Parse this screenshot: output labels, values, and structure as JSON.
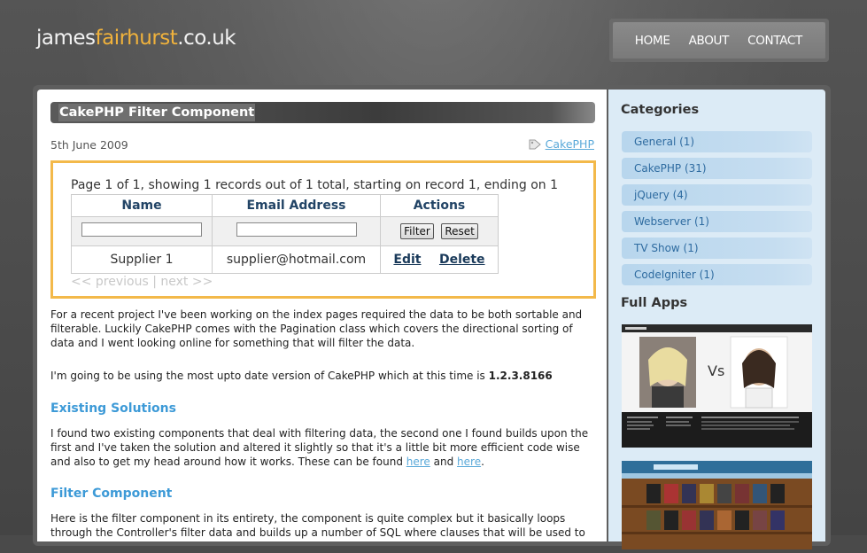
{
  "header": {
    "logo_prefix": "james",
    "logo_accent": "fairhurst",
    "logo_suffix": ".co.uk",
    "nav": [
      "HOME",
      "ABOUT",
      "CONTACT"
    ]
  },
  "post": {
    "title": "CakePHP Filter Component",
    "date": "5th June 2009",
    "tag": "CakePHP"
  },
  "demo": {
    "paging_text": "Page 1 of 1, showing 1 records out of 1 total, starting on record 1, ending on 1",
    "columns": [
      "Name",
      "Email Address",
      "Actions"
    ],
    "filter_button": "Filter",
    "reset_button": "Reset",
    "row": {
      "name": "Supplier 1",
      "email": "supplier@hotmail.com",
      "edit": "Edit",
      "delete": "Delete"
    },
    "previous": "<< previous",
    "separator": "|",
    "next": "next >>"
  },
  "content": {
    "p1": "For a recent project I've been working on the index pages required the data to be both sortable and filterable. Luckily CakePHP comes with the Pagination class which covers the directional sorting of data and I went looking online for something that will filter the data.",
    "p2_text": "I'm going to be using the most upto date version of CakePHP which at this time is ",
    "p2_version": "1.2.3.8166",
    "h1": "Existing Solutions",
    "p3_text": "I found two existing components that deal with filtering data, the second one I found builds upon the first and I've taken the solution and altered it slightly so that it's a little bit more efficient code wise and also to get my head around how it works. These can be found ",
    "p3_link1": "here",
    "p3_and": " and ",
    "p3_link2": "here",
    "p3_end": ".",
    "h2": "Filter Component",
    "p4": "Here is the filter component in its entirety, the component is quite complex but it basically loops through the Controller's filter data and builds up a number of SQL where clauses that will be used to"
  },
  "sidebar": {
    "categories_title": "Categories",
    "categories": [
      "General (1)",
      "CakePHP (31)",
      "jQuery (4)",
      "Webserver (1)",
      "TV Show (1)",
      "CodeIgniter (1)"
    ],
    "apps_title": "Full Apps",
    "app1_vs": "Vs"
  },
  "colors": {
    "accent": "#f0b23c",
    "link": "#5aa9d9",
    "heading": "#3d9ad7",
    "box_border": "#f3b94a"
  }
}
